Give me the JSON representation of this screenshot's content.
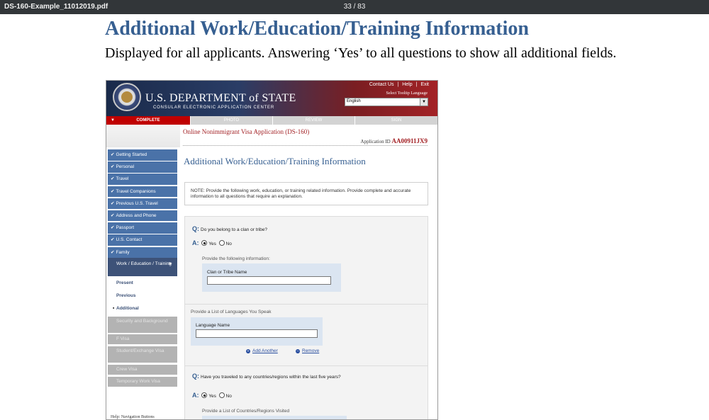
{
  "viewer": {
    "filename": "DS-160-Example_11012019.pdf",
    "page": "33 / 83"
  },
  "doc": {
    "title": "Additional Work/Education/Training Information",
    "subtitle": "Displayed for all applicants. Answering ‘Yes’ to all questions to show all additional fields."
  },
  "site": {
    "links": [
      "Contact Us",
      "|",
      "Help",
      "|",
      "Exit"
    ],
    "dept_name": "U.S. DEPARTMENT of STATE",
    "dept_sub": "CONSULAR ELECTRONIC APPLICATION CENTER",
    "tooltip_label": "Select Tooltip Language",
    "language": "English"
  },
  "progress": {
    "complete": "COMPLETE",
    "photo": "PHOTO",
    "review": "REVIEW",
    "sign": "SIGN"
  },
  "nav": {
    "items": [
      "Getting Started",
      "Personal",
      "Travel",
      "Travel Companions",
      "Previous U.S. Travel",
      "Address and Phone",
      "Passport",
      "U.S. Contact",
      "Family"
    ],
    "current": "Work / Education / Training",
    "sub": [
      "Present",
      "Previous",
      "Additional"
    ],
    "disabled": [
      "Security and Background",
      "F Visa",
      "Student/Exchange Visa",
      "Crew Visa",
      "Temporary Work Visa"
    ],
    "help": "Help: Navigation Buttons"
  },
  "main": {
    "app_title": "Online Nonimmigrant Visa Application (DS-160)",
    "app_id_label": "Application ID",
    "app_id": "AA00911JX9",
    "heading": "Additional Work/Education/Training Information",
    "note": "NOTE: Provide the following work, education, or training related information. Provide complete and accurate information to all questions that require an explanation.",
    "q_prefix": "Q:",
    "a_prefix": "A:",
    "yes": "Yes",
    "no": "No",
    "q1": "Do you belong to a clan or tribe?",
    "q1_hint": "Provide the following information:",
    "clan_label": "Clan or Tribe Name",
    "languages_label": "Provide a List of Languages You Speak",
    "language_name_label": "Language Name",
    "add_another": "Add Another",
    "remove": "Remove",
    "q2": "Have you traveled to any countries/regions within the last five years?",
    "q2_hint": "Provide a List of Countries/Regions Visited"
  }
}
